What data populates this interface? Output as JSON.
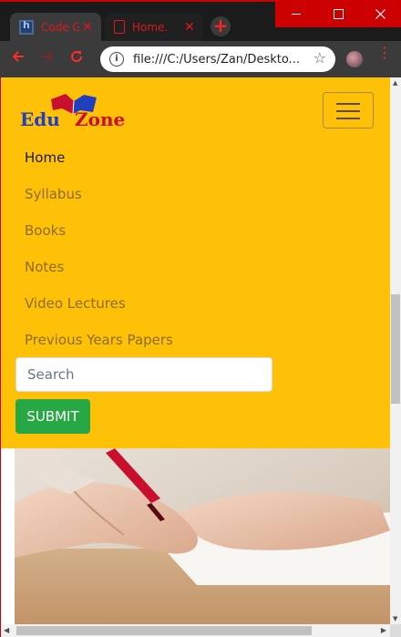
{
  "browser": {
    "tabs": [
      {
        "title": "Code G",
        "close": "✕"
      },
      {
        "title": "Home.",
        "close": "✕"
      }
    ],
    "new_tab": "+",
    "url": "file:///C:/Users/Zan/Deskto...",
    "accent_color": "#cc0000"
  },
  "site": {
    "brand": {
      "word1": "Edu",
      "word2": "Zone"
    },
    "nav": {
      "items": [
        {
          "label": "Home",
          "active": true
        },
        {
          "label": "Syllabus"
        },
        {
          "label": "Books"
        },
        {
          "label": "Notes"
        },
        {
          "label": "Video Lectures"
        },
        {
          "label": "Previous Years Papers"
        }
      ]
    },
    "search": {
      "placeholder": "Search",
      "value": ""
    },
    "submit_label": "SUBMIT",
    "colors": {
      "navbar": "#ffc107",
      "submit": "#28a745",
      "brand_blue": "#1f3fbf",
      "brand_red": "#c8102e"
    }
  }
}
